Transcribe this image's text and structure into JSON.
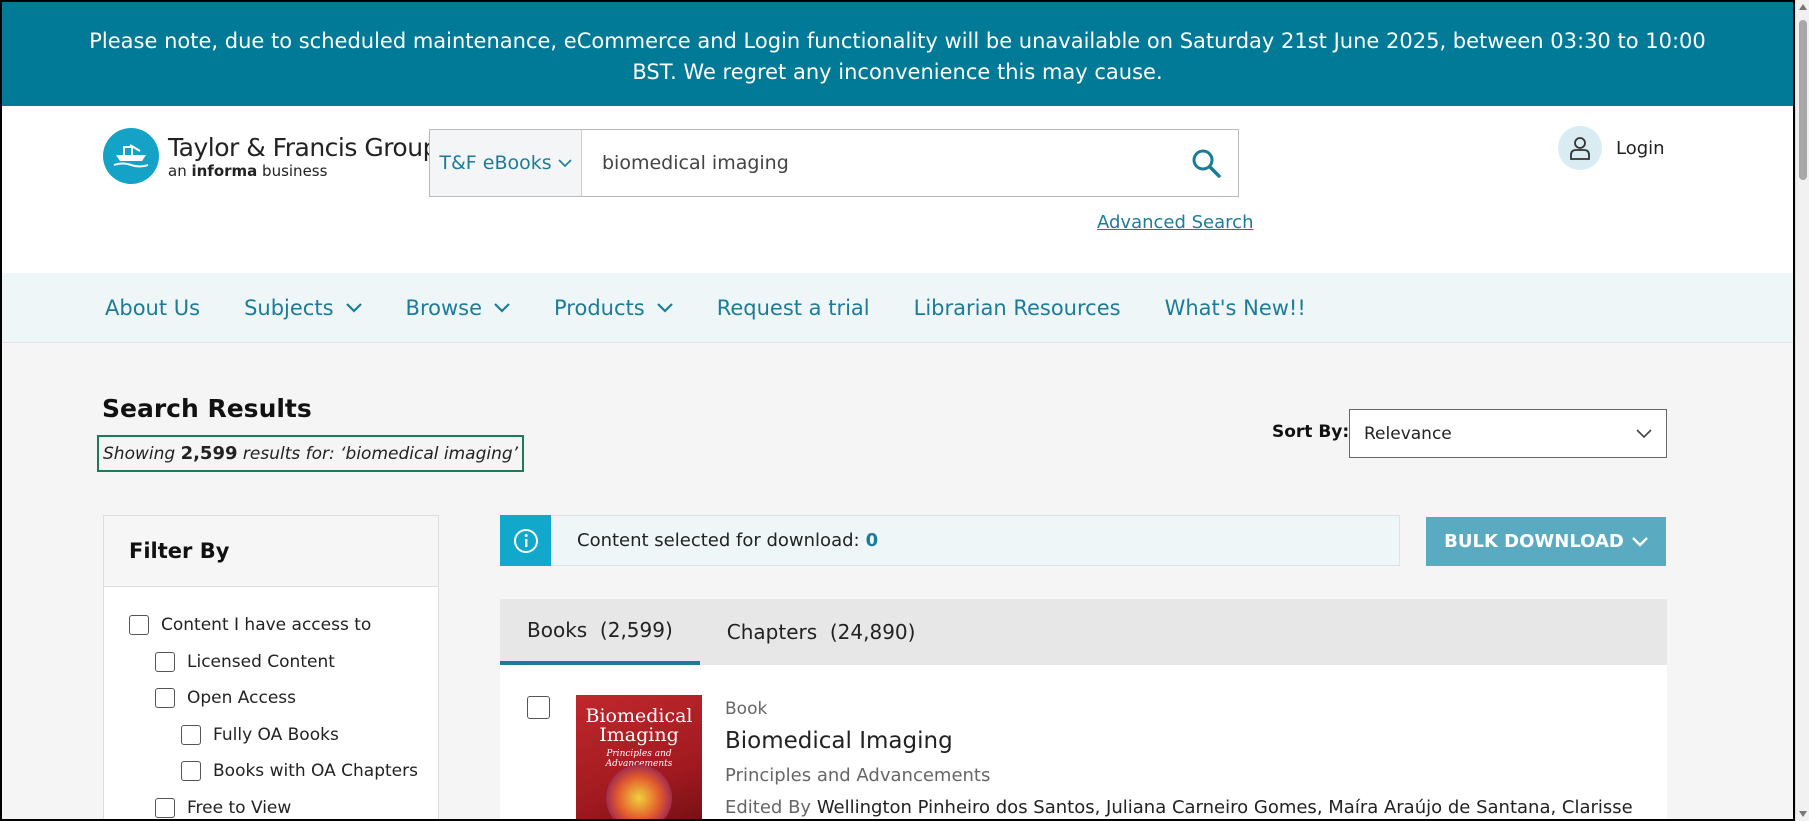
{
  "banner": {
    "text": "Please note, due to scheduled maintenance, eCommerce and Login functionality will be unavailable on Saturday 21st June 2025, between 03:30 to 10:00 BST. We regret any inconvenience this may cause."
  },
  "header": {
    "logo_title": "Taylor & Francis Group",
    "logo_sub_prefix": "an ",
    "logo_sub_bold": "informa",
    "logo_sub_suffix": " business",
    "search_scope": "T&F eBooks",
    "search_value": "biomedical imaging",
    "advanced_search": "Advanced Search",
    "login": "Login"
  },
  "nav": {
    "items": [
      {
        "label": "About Us",
        "dropdown": false
      },
      {
        "label": "Subjects",
        "dropdown": true
      },
      {
        "label": "Browse",
        "dropdown": true
      },
      {
        "label": "Products",
        "dropdown": true
      },
      {
        "label": "Request a trial",
        "dropdown": false
      },
      {
        "label": "Librarian Resources",
        "dropdown": false
      },
      {
        "label": "What's New!!",
        "dropdown": false
      }
    ]
  },
  "results": {
    "title": "Search Results",
    "showing_prefix": "Showing ",
    "count": "2,599",
    "showing_suffix": " results for: ‘biomedical imaging’",
    "sort_label": "Sort By:",
    "sort_value": "Relevance"
  },
  "filter": {
    "title": "Filter By",
    "items": [
      {
        "label": "Content I have access to",
        "indent": 0
      },
      {
        "label": "Licensed Content",
        "indent": 1
      },
      {
        "label": "Open Access",
        "indent": 1
      },
      {
        "label": "Fully OA Books",
        "indent": 2
      },
      {
        "label": "Books with OA Chapters",
        "indent": 2
      },
      {
        "label": "Free to View",
        "indent": 1
      }
    ]
  },
  "download": {
    "text": "Content selected for download:",
    "count": "0",
    "bulk_label": "BULK DOWNLOAD"
  },
  "tabs": [
    {
      "label": "Books  (2,599)",
      "active": true
    },
    {
      "label": "Chapters  (24,890)",
      "active": false
    }
  ],
  "result": {
    "type": "Book",
    "title": "Biomedical Imaging",
    "subtitle": "Principles and Advancements",
    "editors_label": "Edited By ",
    "editors": "Wellington Pinheiro dos Santos, Juliana Carneiro Gomes, Maíra Araújo de Santana, Clarisse",
    "cover_title": "Biomedical Imaging",
    "cover_sub": "Principles and Advancements"
  },
  "colors": {
    "banner": "#007a96",
    "link": "#1b7c99",
    "accent": "#12a8cc"
  }
}
